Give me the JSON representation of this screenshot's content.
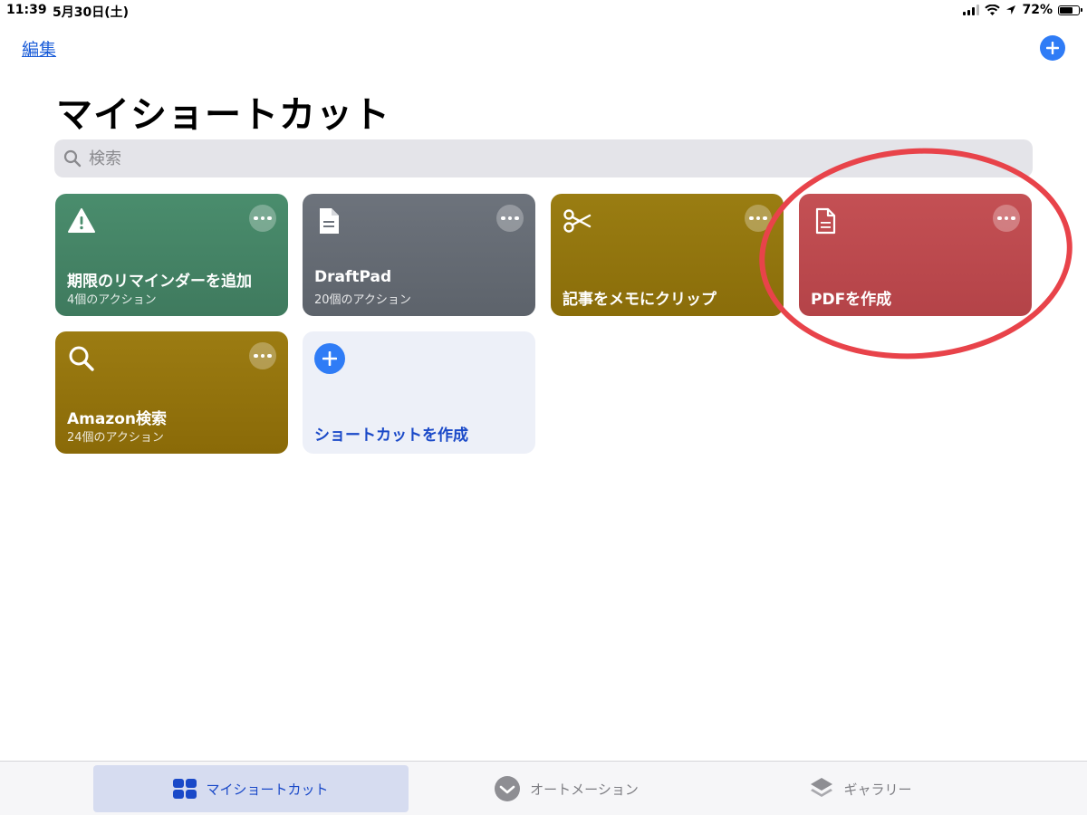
{
  "status_bar": {
    "time": "11:39",
    "date": "5月30日(土)",
    "battery_percent": "72%",
    "battery_level": 0.72
  },
  "nav": {
    "edit_label": "編集"
  },
  "page": {
    "title": "マイショートカット"
  },
  "search": {
    "placeholder": "検索"
  },
  "shortcuts": [
    {
      "title": "期限のリマインダーを追加",
      "subtitle": "4個のアクション",
      "icon": "warning-icon",
      "color": "#4a8d6d"
    },
    {
      "title": "DraftPad",
      "subtitle": "20個のアクション",
      "icon": "document-icon",
      "color": "#6d737c"
    },
    {
      "title": "記事をメモにクリップ",
      "subtitle": "",
      "icon": "scissors-icon",
      "color": "#9a7d12"
    },
    {
      "title": "PDFを作成",
      "subtitle": "",
      "icon": "document-outline-icon",
      "color": "#c45054"
    },
    {
      "title": "Amazon検索",
      "subtitle": "24個のアクション",
      "icon": "search-icon",
      "color": "#9c7c12"
    }
  ],
  "create_card": {
    "label": "ショートカットを作成"
  },
  "tabs": [
    {
      "label": "マイショートカット",
      "icon": "grid-icon",
      "active": true
    },
    {
      "label": "オートメーション",
      "icon": "checkmark-circle-icon",
      "active": false
    },
    {
      "label": "ギャラリー",
      "icon": "layers-icon",
      "active": false
    }
  ],
  "colors": {
    "accent": "#2f7cf6",
    "annotation": "#e8434a"
  }
}
